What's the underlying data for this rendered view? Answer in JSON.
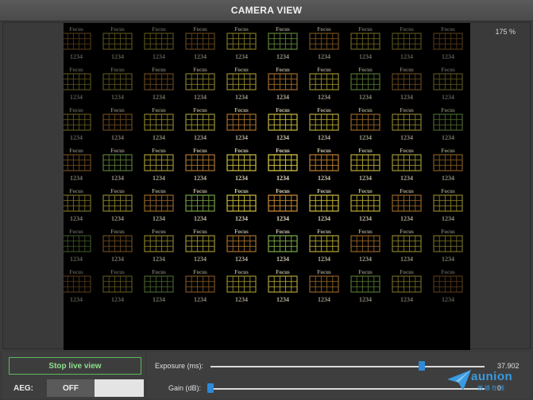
{
  "window": {
    "title": "CAMERA VIEW"
  },
  "view": {
    "zoom_readout": "175 %"
  },
  "target_pattern": {
    "label_top": "Focus",
    "label_bottom": "1234",
    "colors": {
      "grid_bright": "#f2e14a",
      "grid_warm": "#e39a3c",
      "grid_green": "#9bd35a",
      "text": "#f5ead0",
      "background": "#000000"
    }
  },
  "controls": {
    "live_button_label": "Stop live view",
    "aeg": {
      "label": "AEG:",
      "state_label": "OFF",
      "enabled": false
    },
    "exposure": {
      "label": "Exposure (ms):",
      "value": "37.902",
      "level": 0.77
    },
    "gain": {
      "label": "Gain (dB):",
      "value": "0",
      "level": 0.0
    }
  },
  "watermark": {
    "name": "aunion",
    "subtitle": "傲 雄 在 线",
    "icon": "paper-plane-logo-icon"
  },
  "colors": {
    "accent": "#2e8ad8",
    "live_button": "#5dbb5d",
    "panel": "#3e3e3e"
  }
}
